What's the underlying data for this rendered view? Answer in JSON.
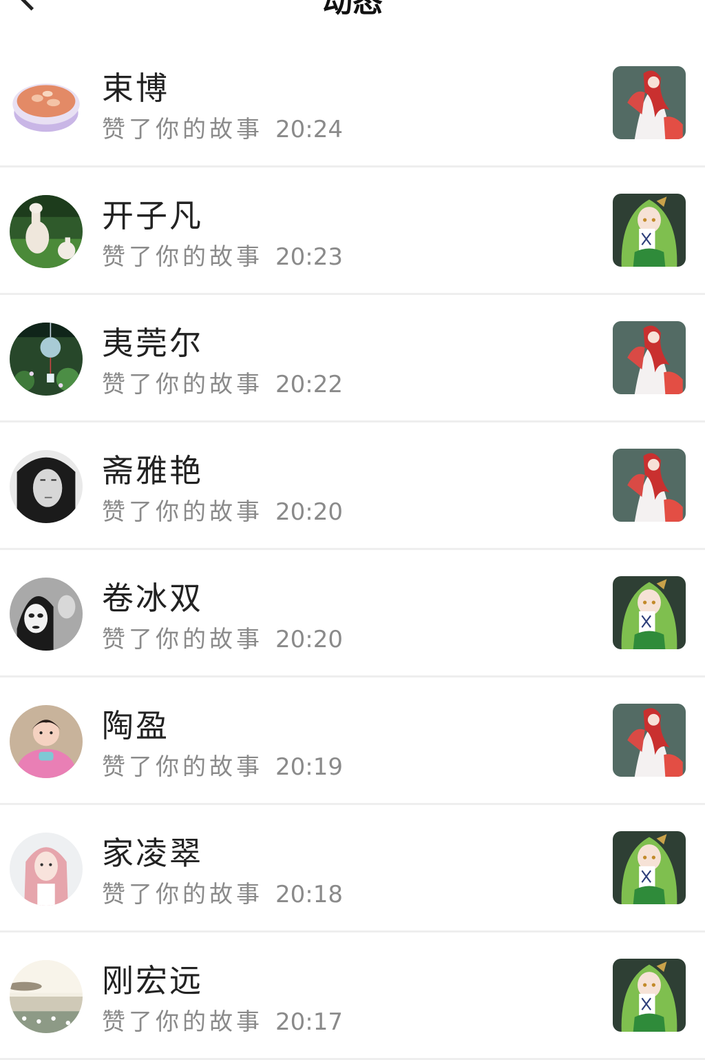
{
  "header": {
    "title": "动态",
    "back_icon": "chevron-left-icon"
  },
  "notifications": [
    {
      "name": "束博",
      "action": "赞了你的故事",
      "time": "20:24",
      "avatar": "soup-bowl",
      "story_thumb": "red-white-anime-girl"
    },
    {
      "name": "开子凡",
      "action": "赞了你的故事",
      "time": "20:23",
      "avatar": "alpaca",
      "story_thumb": "green-hair-anime-girl"
    },
    {
      "name": "夷莞尔",
      "action": "赞了你的故事",
      "time": "20:22",
      "avatar": "wind-chime",
      "story_thumb": "red-white-anime-girl"
    },
    {
      "name": "斋雅艳",
      "action": "赞了你的故事",
      "time": "20:20",
      "avatar": "bw-woman-portrait",
      "story_thumb": "red-white-anime-girl"
    },
    {
      "name": "卷冰双",
      "action": "赞了你的故事",
      "time": "20:20",
      "avatar": "mask-face",
      "story_thumb": "green-hair-anime-girl"
    },
    {
      "name": "陶盈",
      "action": "赞了你的故事",
      "time": "20:19",
      "avatar": "child-pink",
      "story_thumb": "red-white-anime-girl"
    },
    {
      "name": "家凌翠",
      "action": "赞了你的故事",
      "time": "20:18",
      "avatar": "pink-hair-girl",
      "story_thumb": "green-hair-anime-girl"
    },
    {
      "name": "刚宏远",
      "action": "赞了你的故事",
      "time": "20:17",
      "avatar": "seaside-landscape",
      "story_thumb": "green-hair-anime-girl"
    }
  ]
}
